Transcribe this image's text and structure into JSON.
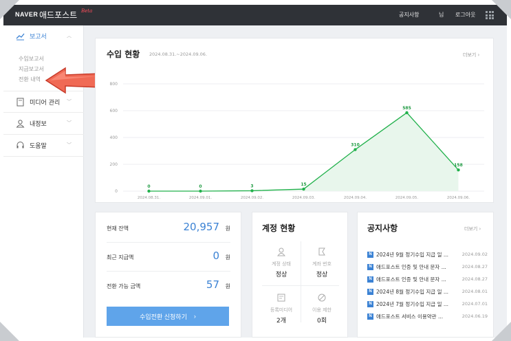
{
  "topbar": {
    "logo_naver": "NAVER",
    "logo_ad": "애드포스트",
    "logo_beta": "Beta",
    "notice_link": "공지사항",
    "user_suffix": "님",
    "logout": "로그아웃"
  },
  "sidebar": {
    "report": {
      "label": "보고서",
      "icon": "trend-chart-icon",
      "expanded": true
    },
    "sub_items": [
      "수입보고서",
      "지급보고서",
      "전환 내역"
    ],
    "media": {
      "label": "미디어 관리",
      "icon": "document-icon"
    },
    "profile": {
      "label": "내정보",
      "icon": "user-icon"
    },
    "help": {
      "label": "도움말",
      "icon": "headset-icon"
    }
  },
  "income": {
    "title": "수입 현황",
    "period": "2024.08.31.~2024.09.06.",
    "more": "더보기"
  },
  "chart_data": {
    "type": "area",
    "categories": [
      "2024.08.31.",
      "2024.09.01.",
      "2024.09.02.",
      "2024.09.03.",
      "2024.09.04.",
      "2024.09.05.",
      "2024.09.06."
    ],
    "values": [
      0,
      0,
      3,
      15,
      310,
      585,
      158
    ],
    "value_labels": [
      "0",
      "0",
      "3",
      "15",
      "310",
      "585",
      "158"
    ],
    "y_ticks": [
      "0",
      "200",
      "400",
      "600",
      "800"
    ],
    "ylim": [
      0,
      800
    ],
    "line_color": "#22b14c",
    "fill_color": "#e8f6ec",
    "grid": true
  },
  "balance": {
    "current_label": "현재 잔액",
    "current_value": "20,957",
    "recent_label": "최근 지급액",
    "recent_value": "0",
    "available_label": "전환 가능 금액",
    "available_value": "57",
    "unit": "원",
    "button": "수입전환 신청하기",
    "button_arrow": "›",
    "accent": "#3b82d4"
  },
  "account": {
    "title": "계정 현황",
    "cells": [
      {
        "label": "계정 상태",
        "value": "정상",
        "icon": "person-icon"
      },
      {
        "label": "계좌 번호",
        "value": "정상",
        "icon": "bank-icon"
      },
      {
        "label": "등록미디어",
        "value": "2개",
        "icon": "media-icon"
      },
      {
        "label": "이용 제한",
        "value": "0회",
        "icon": "ban-icon"
      }
    ]
  },
  "notice": {
    "title": "공지사항",
    "more": "더보기",
    "badge": "N",
    "items": [
      {
        "title": "2024년 9월 정기수입 지급 일 ...",
        "date": "2024.09.02"
      },
      {
        "title": "애드포스트 인증 및 안내 문자 ...",
        "date": "2024.08.27"
      },
      {
        "title": "애드포스트 인증 및 안내 문자 ...",
        "date": "2024.08.27"
      },
      {
        "title": "2024년 8월 정기수입 지급 일 ...",
        "date": "2024.08.01"
      },
      {
        "title": "2024년 7월 정기수입 지급 일 ...",
        "date": "2024.07.01"
      },
      {
        "title": "애드포스트 서비스 이용약관 ...",
        "date": "2024.06.19"
      }
    ]
  }
}
